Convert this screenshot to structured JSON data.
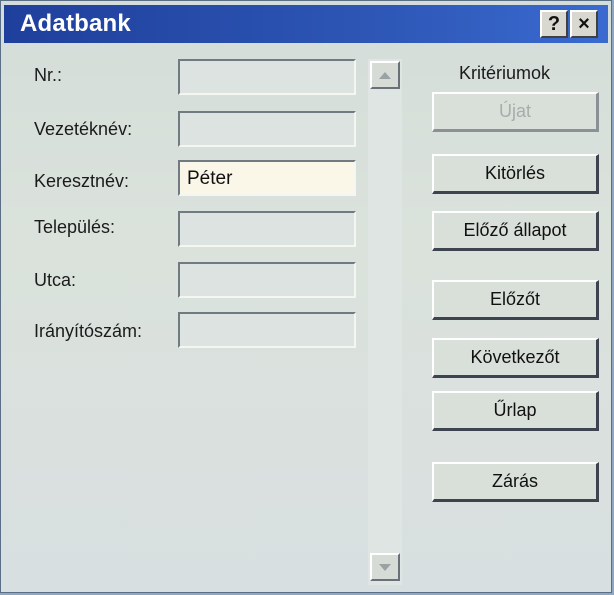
{
  "window": {
    "title": "Adatbank"
  },
  "title_buttons": {
    "help": "?",
    "close": "×"
  },
  "fields": [
    {
      "label": "Nr.:",
      "value": ""
    },
    {
      "label": "Vezetéknév:",
      "value": ""
    },
    {
      "label": "Keresztnév:",
      "value": "Péter"
    },
    {
      "label": "Település:",
      "value": ""
    },
    {
      "label": "Utca:",
      "value": ""
    },
    {
      "label": "Irányítószám:",
      "value": ""
    }
  ],
  "criteria_label": "Kritériumok",
  "buttons": {
    "new": "Újat",
    "delete": "Kitörlés",
    "restore": "Előző állapot",
    "prev": "Előzőt",
    "next": "Következőt",
    "form": "Űrlap",
    "close": "Zárás"
  },
  "scroll_icons": {
    "up": "scroll-up-arrow",
    "down": "scroll-down-arrow"
  },
  "colors": {
    "titlebar": "#2d56b5",
    "window_bg": "#d8dfdc",
    "active_field": "#fbf7e8"
  }
}
